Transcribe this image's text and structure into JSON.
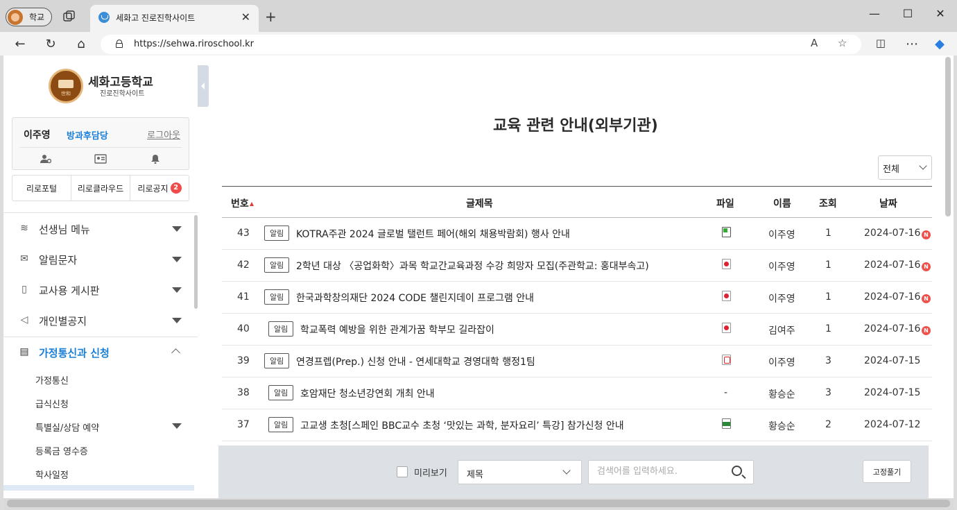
{
  "browser": {
    "profile_label": "학교",
    "tab_title": "세화고 진로진학사이트",
    "url": "https://sehwa.riroschool.kr"
  },
  "sidebar": {
    "school_name": "세화고등학교",
    "school_sub": "진로진학사이트",
    "logo_mark": "世和",
    "user_name": "이주영",
    "user_role": "방과후담당",
    "logout": "로그아웃",
    "quicklinks": [
      "리로포털",
      "리로클라우드",
      "리로공지"
    ],
    "notice_badge": "2",
    "menu": [
      {
        "label": "선생님 메뉴",
        "icon": "layers-icon"
      },
      {
        "label": "알림문자",
        "icon": "mail-icon"
      },
      {
        "label": "교사용 게시판",
        "icon": "clipboard-icon"
      },
      {
        "label": "개인별공지",
        "icon": "megaphone-icon"
      },
      {
        "label": "가정통신과 신청",
        "icon": "document-icon"
      }
    ],
    "submenu": [
      "가정통신",
      "급식신청",
      "특별실/상담 예약",
      "등록금 영수증",
      "학사일정"
    ]
  },
  "main": {
    "title": "교육 관련 안내(외부기관)",
    "filter_value": "전체",
    "columns": {
      "num": "번호",
      "title": "글제목",
      "file": "파일",
      "name": "이름",
      "views": "조회",
      "date": "날짜"
    },
    "tag_label": "알림",
    "new_label": "N",
    "rows": [
      {
        "num": "43",
        "title": "KOTRA주관 2024 글로벌 탤런트 페어(해외 채용박람회) 행사 안내",
        "file": "xls-icon",
        "name": "이주영",
        "views": "1",
        "date": "2024-07-16",
        "new": true
      },
      {
        "num": "42",
        "title": "2학년 대상 〈공업화학〉과목 학교간교육과정 수강 희망자 모집(주관학교: 홍대부속고)",
        "file": "hwp-icon",
        "name": "이주영",
        "views": "1",
        "date": "2024-07-16",
        "new": true
      },
      {
        "num": "41",
        "title": "한국과학창의재단 2024 CODE 챌린지데이 프로그램 안내",
        "file": "hwp-icon",
        "name": "이주영",
        "views": "1",
        "date": "2024-07-16",
        "new": true
      },
      {
        "num": "40",
        "title": "학교폭력 예방을 위한 관계가꿈 학부모 길라잡이",
        "file": "hwp-icon",
        "name": "김여주",
        "views": "1",
        "date": "2024-07-16",
        "new": true
      },
      {
        "num": "39",
        "title": "연경프렙(Prep.) 신청 안내 - 연세대학교 경영대학 행정1팀",
        "file": "pdf-icon",
        "name": "이주영",
        "views": "3",
        "date": "2024-07-15",
        "new": false
      },
      {
        "num": "38",
        "title": "호암재단 청소년강연회 개최 안내",
        "file": "-",
        "name": "황승순",
        "views": "3",
        "date": "2024-07-15",
        "new": false
      },
      {
        "num": "37",
        "title": "고교생 초청[스페인 BBC교수 초청 ‘맛있는 과학, 분자요리’ 특강] 참가신청 안내",
        "file": "xls-icon",
        "name": "황승순",
        "views": "2",
        "date": "2024-07-12",
        "new": false
      }
    ]
  },
  "search": {
    "preview_label": "미리보기",
    "field_value": "제목",
    "placeholder": "검색어를 입력하세요.",
    "unpin_label": "고정풀기"
  },
  "colors": {
    "accent": "#1a7fd6",
    "badge": "#f04b4b",
    "brand": "#8b4b13"
  }
}
